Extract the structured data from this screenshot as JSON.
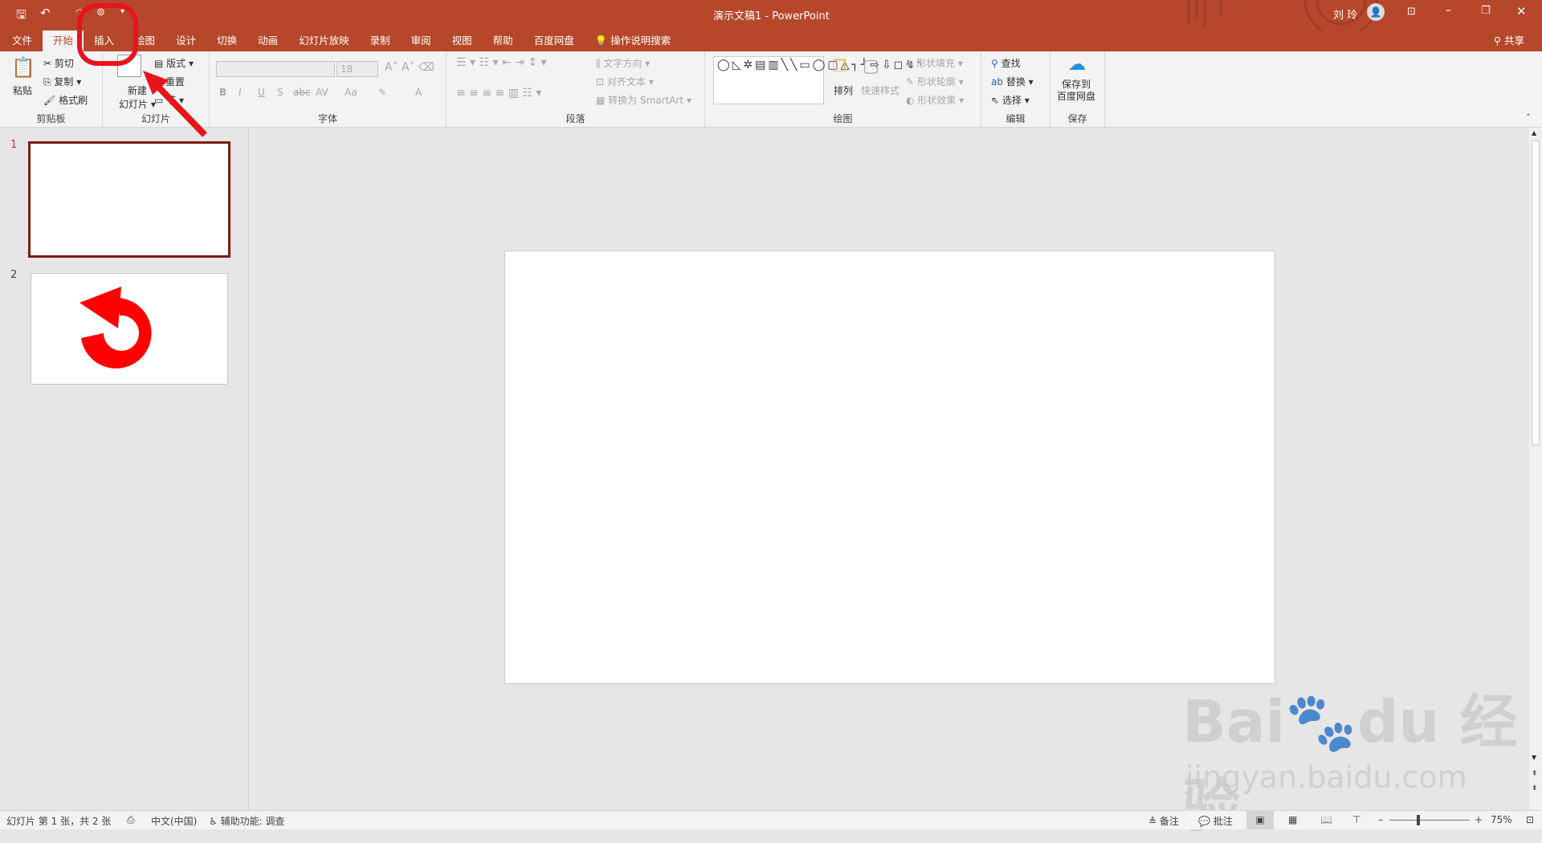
{
  "titlebar": {
    "title": "演示文稿1  -  PowerPoint",
    "user": "刘 玲",
    "share": "共享"
  },
  "tabs": [
    {
      "label": "文件"
    },
    {
      "label": "开始"
    },
    {
      "label": "插入"
    },
    {
      "label": "绘图"
    },
    {
      "label": "设计"
    },
    {
      "label": "切换"
    },
    {
      "label": "动画"
    },
    {
      "label": "幻灯片放映"
    },
    {
      "label": "录制"
    },
    {
      "label": "审阅"
    },
    {
      "label": "视图"
    },
    {
      "label": "帮助"
    },
    {
      "label": "百度网盘"
    }
  ],
  "tell_me": "操作说明搜索",
  "ribbon": {
    "clipboard": {
      "label": "剪贴板",
      "paste": "粘贴",
      "cut": "剪切",
      "copy": "复制",
      "format_painter": "格式刷"
    },
    "slides": {
      "label": "幻灯片",
      "new_slide_1": "新建",
      "new_slide_2": "幻灯片",
      "layout": "版式",
      "reset": "重置",
      "section": "节"
    },
    "font": {
      "label": "字体",
      "font_name": "",
      "font_size": "18",
      "bold": "B",
      "italic": "I",
      "underline": "U",
      "shadow": "S",
      "strike": "abc",
      "spacing": "AV",
      "case": "Aa",
      "color": "A"
    },
    "paragraph": {
      "label": "段落",
      "text_direction": "文字方向",
      "align_text": "对齐文本",
      "smartart": "转换为 SmartArt"
    },
    "drawing": {
      "label": "绘图",
      "arrange": "排列",
      "quick_styles": "快速样式",
      "shape_fill": "形状填充",
      "shape_outline": "形状轮廓",
      "shape_effects": "形状效果"
    },
    "editing": {
      "label": "编辑",
      "find": "查找",
      "replace": "替换",
      "select": "选择"
    },
    "save": {
      "label": "保存",
      "save_1": "保存到",
      "save_2": "百度网盘"
    }
  },
  "thumbnails": [
    {
      "number": "1",
      "selected": true
    },
    {
      "number": "2",
      "selected": false
    }
  ],
  "status": {
    "slide_info": "幻灯片 第 1 张，共 2 张",
    "language": "中文(中国)",
    "accessibility": "辅助功能: 调查",
    "notes": "备注",
    "comments": "批注",
    "zoom": "75%",
    "zoom_percent": 75
  },
  "watermark": {
    "logo": "Bai du 经验",
    "url": "jingyan.baidu.com"
  },
  "colors": {
    "accent": "#b7472a",
    "annotation": "#e8141c"
  }
}
